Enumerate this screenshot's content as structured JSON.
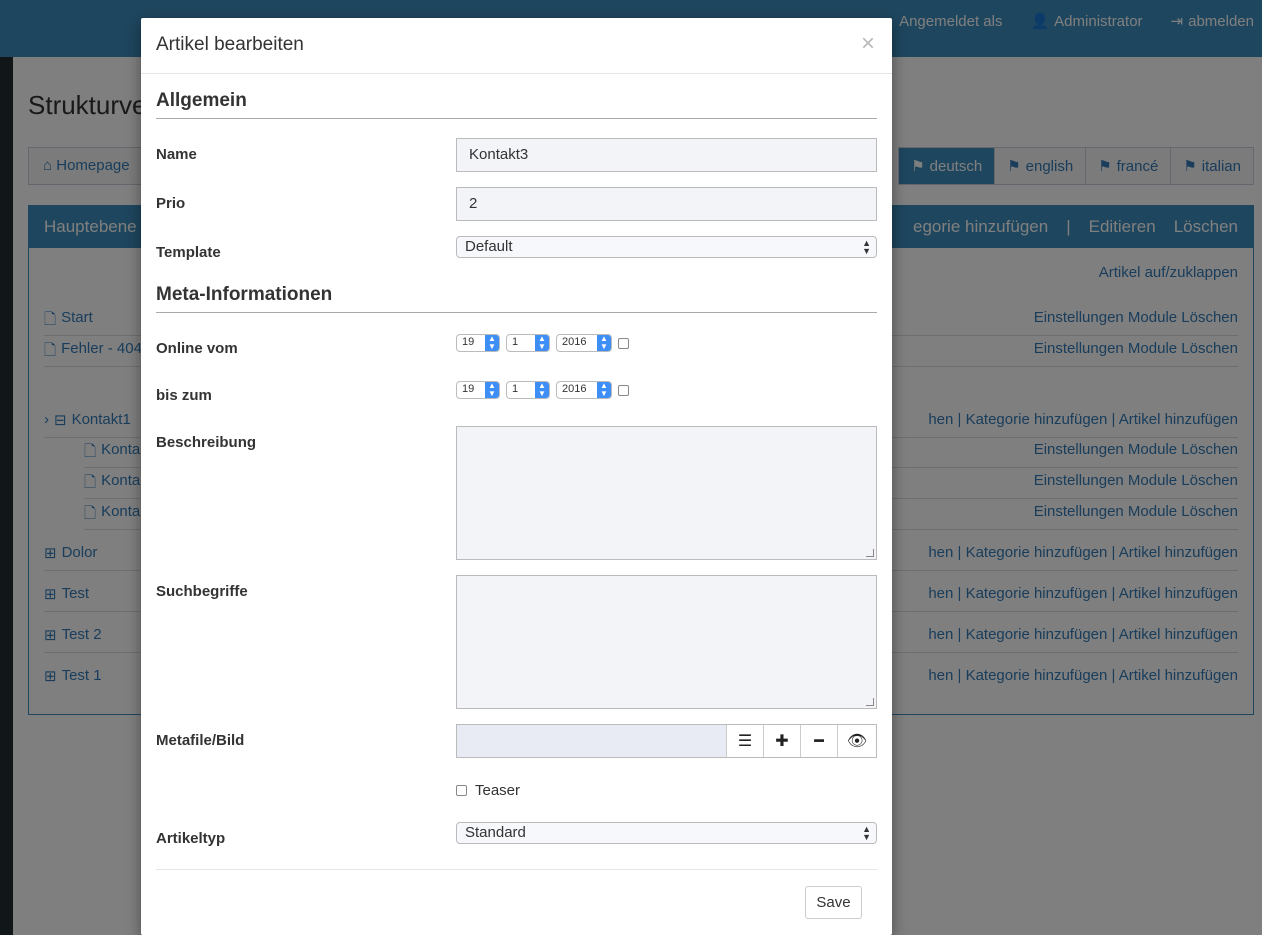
{
  "topbar": {
    "logged_in_as": "Angemeldet als",
    "user": "Administrator",
    "logout": "abmelden"
  },
  "bg": {
    "page_title": "Strukturve",
    "crumb": "Homepage",
    "langs": [
      "deutsch",
      "english",
      "francé",
      "italian"
    ],
    "panel_head": "Hauptebene",
    "panel_actions": [
      "egorie hinzufügen",
      "|",
      "Editieren",
      "Löschen"
    ],
    "toggle": "Artikel auf/zuklappen",
    "rows": [
      {
        "label": "Start",
        "right": "Einstellungen Module Löschen"
      },
      {
        "label": "Fehler - 404",
        "right": "Einstellungen Module Löschen"
      },
      {
        "label": "Kontakt1",
        "right": "hen | Kategorie hinzufügen | Artikel hinzufügen"
      },
      {
        "label": "Konta",
        "right": "Einstellungen Module Löschen"
      },
      {
        "label": "Konta",
        "right": "Einstellungen Module Löschen"
      },
      {
        "label": "Konta",
        "right": "Einstellungen Module Löschen"
      },
      {
        "label": "Dolor",
        "right": "hen | Kategorie hinzufügen | Artikel hinzufügen"
      },
      {
        "label": "Test",
        "right": "hen | Kategorie hinzufügen | Artikel hinzufügen"
      },
      {
        "label": "Test 2",
        "right": "hen | Kategorie hinzufügen | Artikel hinzufügen"
      },
      {
        "label": "Test 1",
        "right": "hen | Kategorie hinzufügen | Artikel hinzufügen"
      }
    ]
  },
  "modal": {
    "title": "Artikel bearbeiten",
    "close": "×",
    "section_general": "Allgemein",
    "name_label": "Name",
    "name_value": "Kontakt3",
    "prio_label": "Prio",
    "prio_value": "2",
    "template_label": "Template",
    "template_value": "Default",
    "section_meta": "Meta-Informationen",
    "online_label": "Online vom",
    "online": {
      "day": "19",
      "month": "1",
      "year": "2016"
    },
    "until_label": "bis zum",
    "until": {
      "day": "19",
      "month": "1",
      "year": "2016"
    },
    "desc_label": "Beschreibung",
    "keywords_label": "Suchbegriffe",
    "metafile_label": "Metafile/Bild",
    "teaser_label": "Teaser",
    "type_label": "Artikeltyp",
    "type_value": "Standard",
    "save": "Save"
  }
}
